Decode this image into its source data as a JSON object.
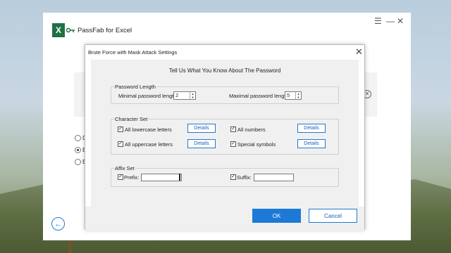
{
  "app": {
    "title": "PassFab for Excel",
    "logo_letter": "X",
    "menu_icon": "hamburger-icon",
    "minimize_icon": "minimize-icon",
    "close_icon": "close-icon"
  },
  "background": {
    "radio_options": [
      {
        "label": "D",
        "selected": false
      },
      {
        "label": "B",
        "selected": true
      },
      {
        "label": "B",
        "selected": false
      }
    ],
    "back_icon": "arrow-left-icon"
  },
  "dialog": {
    "title": "Brute Force with Mask Attack Settings",
    "heading": "Tell Us What You Know About The Password",
    "password_length": {
      "group_title": "Password Length",
      "min_label": "Minimal password length",
      "min_value": "2",
      "max_label": "Maximal password length",
      "max_value": "5"
    },
    "character_set": {
      "group_title": "Character Set",
      "options": [
        {
          "label": "All lowercase letters",
          "checked": true,
          "details": "Details"
        },
        {
          "label": "All numbers",
          "checked": true,
          "details": "Details"
        },
        {
          "label": "All uppercase letters",
          "checked": true,
          "details": "Details"
        },
        {
          "label": "Special symbols",
          "checked": true,
          "details": "Details"
        }
      ]
    },
    "affix_set": {
      "group_title": "Affix Set",
      "prefix_label": "Prefix:",
      "prefix_value": "",
      "suffix_label": "Suffix:",
      "suffix_value": ""
    },
    "ok_label": "OK",
    "cancel_label": "Cancel"
  },
  "colors": {
    "accent": "#1c7ad6",
    "excel_green": "#1e7145"
  }
}
